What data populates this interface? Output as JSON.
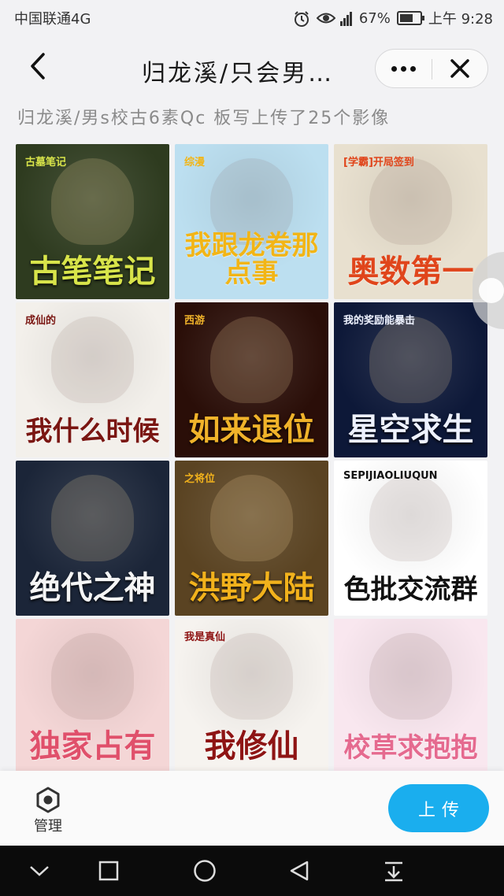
{
  "status_bar": {
    "carrier": "中国联通4G",
    "network": "4G",
    "battery": "67%",
    "battery_level": 0.67,
    "time": "上午 9:28"
  },
  "nav": {
    "title": "归龙溪/只会男…",
    "back_icon": "chevron-left-icon",
    "more_icon": "more-dots-icon",
    "close_icon": "close-icon"
  },
  "album": {
    "caption": "归龙溪/男s校古6素Qc 板写上传了25个影像"
  },
  "covers": [
    {
      "title": "古笔笔记",
      "sub": "古墓笔记",
      "bg": "#2e3b1f",
      "color": "#d8e44a"
    },
    {
      "title": "我跟龙卷那点事",
      "sub": "综漫",
      "bg": "#bcdff0",
      "color": "#f2b516"
    },
    {
      "title": "奥数第一",
      "sub": "[学霸]开局签到",
      "bg": "#e8e0cf",
      "color": "#e0451b"
    },
    {
      "title": "我什么时候",
      "sub": "成仙的",
      "bg": "#f3f0eb",
      "color": "#7a1612"
    },
    {
      "title": "如来退位",
      "sub": "西游",
      "bg": "#2a0e08",
      "color": "#f0b32a"
    },
    {
      "title": "星空求生",
      "sub": "我的奖励能暴击",
      "bg": "#0d1838",
      "color": "#eef2ff"
    },
    {
      "title": "绝代之神",
      "sub": "",
      "bg": "#1b2538",
      "color": "#f5f5f5"
    },
    {
      "title": "洪野大陆",
      "sub": "之将位",
      "bg": "#5a4322",
      "color": "#f2b21c"
    },
    {
      "title": "色批交流群",
      "sub": "SEPIJIAOLIUQUN",
      "bg": "#ffffff",
      "color": "#111111"
    },
    {
      "title": "独家占有",
      "sub": "",
      "bg": "#f4d6d6",
      "color": "#e0506b"
    },
    {
      "title": "我修仙",
      "sub": "我是真仙",
      "bg": "#f6f3ef",
      "color": "#8e1414"
    },
    {
      "title": "校草求抱抱",
      "sub": "",
      "bg": "#f9e7ef",
      "color": "#e56a8f"
    }
  ],
  "bottom": {
    "manage_label": "管理",
    "upload_label": "上传"
  },
  "colors": {
    "accent": "#1aaeee",
    "background": "#f2f2f4"
  }
}
